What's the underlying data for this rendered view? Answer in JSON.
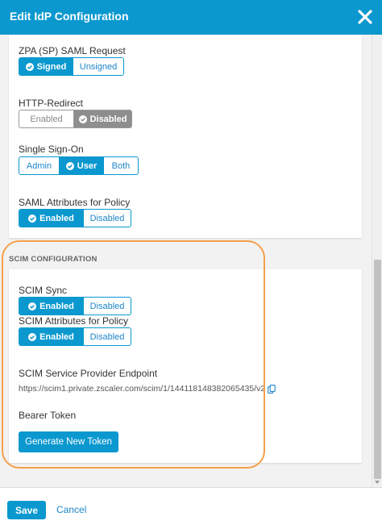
{
  "dialog": {
    "title": "Edit IdP Configuration",
    "close_icon": "close-icon"
  },
  "zpa_saml_request": {
    "label": "ZPA (SP) SAML Request",
    "options": [
      "Signed",
      "Unsigned"
    ],
    "selected": "Signed"
  },
  "http_redirect": {
    "label": "HTTP-Redirect",
    "options": [
      "Enabled",
      "Disabled"
    ],
    "selected": "Disabled"
  },
  "single_sign_on": {
    "label": "Single Sign-On",
    "options": [
      "Admin",
      "User",
      "Both"
    ],
    "selected": "User"
  },
  "saml_attributes": {
    "label": "SAML Attributes for Policy",
    "options": [
      "Enabled",
      "Disabled"
    ],
    "selected": "Enabled"
  },
  "scim": {
    "section_title": "SCIM CONFIGURATION",
    "sync": {
      "label": "SCIM Sync",
      "options": [
        "Enabled",
        "Disabled"
      ],
      "selected": "Enabled"
    },
    "attributes": {
      "label": "SCIM Attributes for Policy",
      "options": [
        "Enabled",
        "Disabled"
      ],
      "selected": "Enabled"
    },
    "endpoint_label": "SCIM Service Provider Endpoint",
    "endpoint_value": "https://scim1.private.zscaler.com/scim/1/144118148382065435/v2",
    "bearer_label": "Bearer Token",
    "generate_label": "Generate New Token"
  },
  "footer": {
    "save_label": "Save",
    "cancel_label": "Cancel"
  },
  "colors": {
    "accent": "#0a98cf",
    "disabled_active": "#8e8e8e",
    "highlight": "#f5a04a"
  }
}
